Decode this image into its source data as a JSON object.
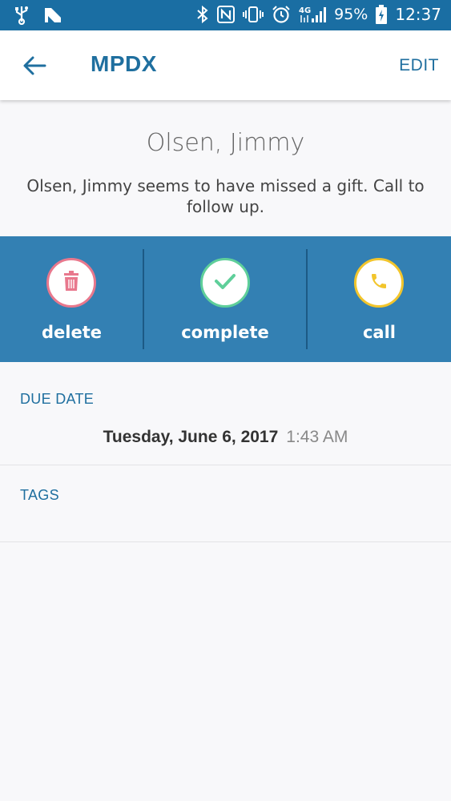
{
  "status_bar": {
    "battery": "95%",
    "time": "12:37",
    "left_icons": [
      "usb-icon",
      "n-icon"
    ],
    "right_icons": [
      "bluetooth-icon",
      "nfc-icon",
      "vibrate-icon",
      "alarm-icon",
      "lte-icon",
      "signal-icon",
      "battery-charging-icon"
    ]
  },
  "app_bar": {
    "title": "MPDX",
    "edit_label": "EDIT",
    "back_icon": "arrow-left-icon"
  },
  "task": {
    "contact_name": "Olsen, Jimmy",
    "description": "Olsen, Jimmy seems to have missed a gift. Call to follow up."
  },
  "actions": [
    {
      "label": "delete",
      "icon": "trash-icon",
      "color": "#e8788d"
    },
    {
      "label": "complete",
      "icon": "check-icon",
      "color": "#5fcf9a"
    },
    {
      "label": "call",
      "icon": "phone-icon",
      "color": "#f2c52c"
    }
  ],
  "due_date": {
    "section_label": "DUE DATE",
    "date": "Tuesday, June 6, 2017",
    "time": "1:43 AM"
  },
  "tags": {
    "section_label": "TAGS"
  },
  "colors": {
    "status_bar": "#1a6ea3",
    "accent": "#1f6f9f",
    "action_bar": "#3380b3"
  }
}
